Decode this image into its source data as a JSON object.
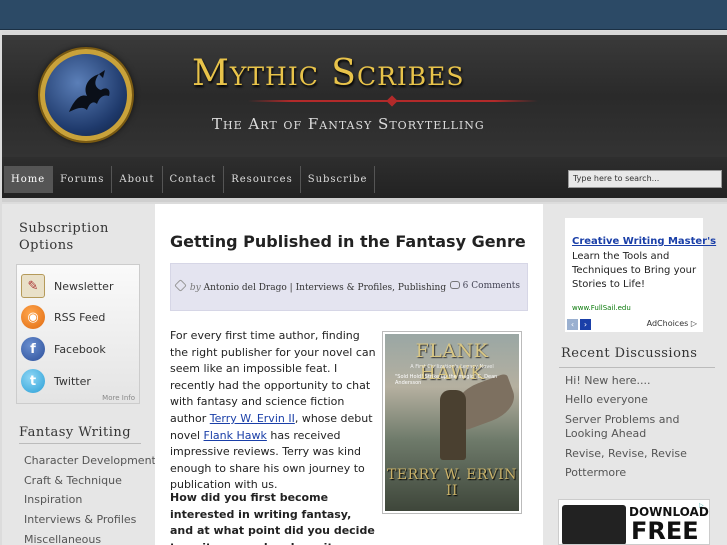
{
  "site": {
    "title": "Mythic Scribes",
    "tagline": "The Art of Fantasy Storytelling"
  },
  "nav": {
    "items": [
      "Home",
      "Forums",
      "About",
      "Contact",
      "Resources",
      "Subscribe"
    ],
    "search_placeholder": "Type here to search..."
  },
  "left_sidebar": {
    "subscription_heading": "Subscription Options",
    "subscription_items": [
      "Newsletter",
      "RSS Feed",
      "Facebook",
      "Twitter"
    ],
    "more_info": "More Info",
    "fantasy_writing_heading": "Fantasy Writing",
    "fantasy_writing_items": [
      "Character Development",
      "Craft & Technique",
      "Inspiration",
      "Interviews & Profiles",
      "Miscellaneous"
    ]
  },
  "post": {
    "title": "Getting Published in the Fantasy Genre",
    "by": "by",
    "author": "Antonio del Drago",
    "separator": "|",
    "categories": "Interviews & Profiles, Publishing",
    "comments": "6 Comments",
    "body_1": "For every first time author, finding the right publisher for your novel can seem like an impossible feat.  I recently had the opportunity to chat with fantasy and science fiction author ",
    "link_author": "Terry W. Ervin II",
    "body_2": ", whose debut novel ",
    "link_novel": "Flank Hawk",
    "body_3": " has received impressive reviews.  Terry was kind enough to share his own journey to publication with us.",
    "question": "How did you first become interested in writing fantasy, and at what point did you decide to write a novel and see it"
  },
  "book_cover": {
    "title": "FLANK HAWK",
    "subtitle": "A First Civilization's Legacy Novel",
    "quote": "\"Sold Hold! Strike up the magic\" C. Dean Andersson",
    "author": "TERRY W. ERVIN II"
  },
  "right_sidebar": {
    "ad": {
      "title": "Creative Writing Master's",
      "text": "Learn the Tools and Techniques to Bring your Stories to Life!",
      "url": "www.FullSail.edu",
      "adchoices": "AdChoices",
      "prev": "‹",
      "next": "›"
    },
    "recent_heading": "Recent Discussions",
    "recent_items": [
      "Hi! New here....",
      "Hello everyone",
      "Server Problems and Looking Ahead",
      "Revise, Revise, Revise",
      "Pottermore"
    ],
    "banner": {
      "line1": "DOWNLOAD A",
      "line2": "FREE"
    }
  },
  "colors": {
    "topbar": "#2c4a66",
    "title_gold": "#e8c34a",
    "link_blue": "#1a3fa8",
    "meta_box": "#e4e4f0"
  }
}
